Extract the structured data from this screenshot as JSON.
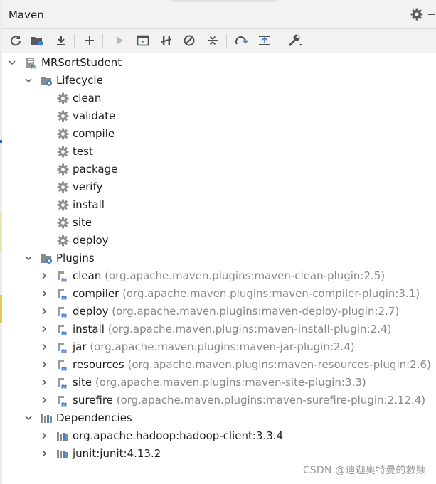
{
  "header": {
    "title": "Maven"
  },
  "toolbar": {
    "buttons": [
      {
        "icon": "reload-icon"
      },
      {
        "icon": "generate-sources-icon"
      },
      {
        "icon": "download-icon"
      },
      {
        "icon": "add-icon"
      },
      {
        "icon": "run-icon"
      },
      {
        "icon": "run-config-icon"
      },
      {
        "icon": "toggle-offline-icon"
      },
      {
        "icon": "skip-tests-icon"
      },
      {
        "icon": "collapse-icon"
      },
      {
        "icon": "show-dependencies-icon"
      },
      {
        "icon": "analyze-icon"
      },
      {
        "icon": "settings-wrench-icon"
      }
    ]
  },
  "tree": {
    "project": "MRSortStudent",
    "lifecycle": {
      "label": "Lifecycle",
      "phases": [
        "clean",
        "validate",
        "compile",
        "test",
        "package",
        "verify",
        "install",
        "site",
        "deploy"
      ]
    },
    "plugins": {
      "label": "Plugins",
      "items": [
        {
          "name": "clean",
          "coords": "(org.apache.maven.plugins:maven-clean-plugin:2.5)"
        },
        {
          "name": "compiler",
          "coords": "(org.apache.maven.plugins:maven-compiler-plugin:3.1)"
        },
        {
          "name": "deploy",
          "coords": "(org.apache.maven.plugins:maven-deploy-plugin:2.7)"
        },
        {
          "name": "install",
          "coords": "(org.apache.maven.plugins:maven-install-plugin:2.4)"
        },
        {
          "name": "jar",
          "coords": "(org.apache.maven.plugins:maven-jar-plugin:2.4)"
        },
        {
          "name": "resources",
          "coords": "(org.apache.maven.plugins:maven-resources-plugin:2.6)"
        },
        {
          "name": "site",
          "coords": "(org.apache.maven.plugins:maven-site-plugin:3.3)"
        },
        {
          "name": "surefire",
          "coords": "(org.apache.maven.plugins:maven-surefire-plugin:2.12.4)"
        }
      ]
    },
    "dependencies": {
      "label": "Dependencies",
      "items": [
        "org.apache.hadoop:hadoop-client:3.3.4",
        "junit:junit:4.13.2"
      ]
    }
  },
  "watermark": "CSDN @迪迦奥特曼的救赎"
}
